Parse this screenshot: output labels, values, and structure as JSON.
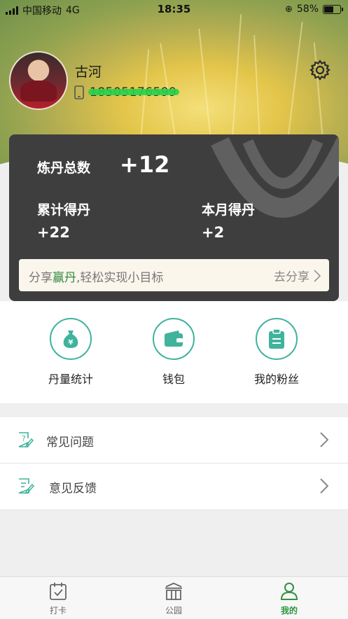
{
  "status_bar": {
    "carrier": "中国移动",
    "network": "4G",
    "time": "18:35",
    "battery": "58%"
  },
  "profile": {
    "name": "古河",
    "phone": "18505176599"
  },
  "summary": {
    "total_label": "炼丹总数",
    "total_value": "+12",
    "cumulative_label": "累计得丹",
    "cumulative_value": "+22",
    "month_label": "本月得丹",
    "month_value": "+2"
  },
  "share": {
    "text_prefix": "分享",
    "text_highlight": "赢丹",
    "text_suffix": ",轻松实现小目标",
    "button": "去分享"
  },
  "quick_actions": [
    {
      "label": "丹量统计",
      "icon": "money-bag-icon"
    },
    {
      "label": "钱包",
      "icon": "wallet-icon"
    },
    {
      "label": "我的粉丝",
      "icon": "clipboard-icon"
    }
  ],
  "menu": [
    {
      "label": "常见问题",
      "icon": "question-doc-icon"
    },
    {
      "label": "意见反馈",
      "icon": "feedback-edit-icon"
    }
  ],
  "tabs": [
    {
      "label": "打卡",
      "icon": "calendar-check-icon"
    },
    {
      "label": "公园",
      "icon": "park-gate-icon"
    },
    {
      "label": "我的",
      "icon": "person-icon"
    }
  ],
  "colors": {
    "accent_green": "#2e9440",
    "icon_teal": "#3fb39c",
    "card_bg": "#3e3e3e",
    "highlight_green": "#2f8a3e"
  }
}
